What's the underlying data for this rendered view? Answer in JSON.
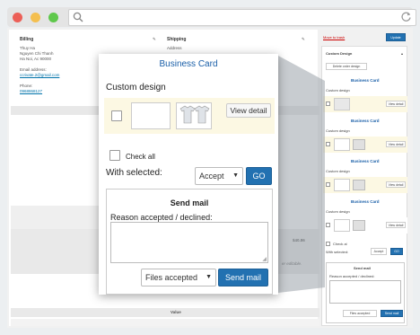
{
  "browser": {
    "traffic_colors": [
      "#ec5f57",
      "#f4bf4f",
      "#5fc84b"
    ]
  },
  "order": {
    "billing_title": "Billing",
    "billing_lines": [
      "Thuy Ha",
      "Nguyen Chi Thanh",
      "Ha Noi, Ac 90000"
    ],
    "email_label": "Email address:",
    "email_value": "ccrivate.2@gmail.com",
    "phone_label": "Phone:",
    "phone_value": "0968868127",
    "shipping_title": "Shipping",
    "shipping_address_label": "Address",
    "amount": "$40.86",
    "note": "er editable.",
    "value_header": "Value"
  },
  "sidebar": {
    "move_to_trash": "Move to trash",
    "update_button": "Update",
    "panel_title": "Custom Design",
    "delete_button": "Delete order design",
    "card_title": "Business Card",
    "custom_design_label": "Custom design",
    "view_detail": "View detail",
    "check_all": "Check al",
    "with_selected": "With selected:",
    "accept": "Accept",
    "go": "GO",
    "send_mail_title": "Send mail",
    "reason_label": "Reason accepted / declined:",
    "files_accepted": "Files accepted",
    "send_mail_button": "Send mail"
  },
  "modal": {
    "title": "Business Card",
    "custom_design_label": "Custom design",
    "view_detail_button": "View detail",
    "check_all_label": "Check all",
    "with_selected_label": "With selected:",
    "action_select": "Accept",
    "go_button": "GO",
    "send_mail_title": "Send mail",
    "reason_label": "Reason accepted / declined:",
    "reason_value": "",
    "status_select": "Files accepted",
    "send_mail_button": "Send mail"
  },
  "colors": {
    "accent": "#2271b1",
    "highlight_bg": "#fcf8e3",
    "title_blue": "#1a5fa8"
  }
}
